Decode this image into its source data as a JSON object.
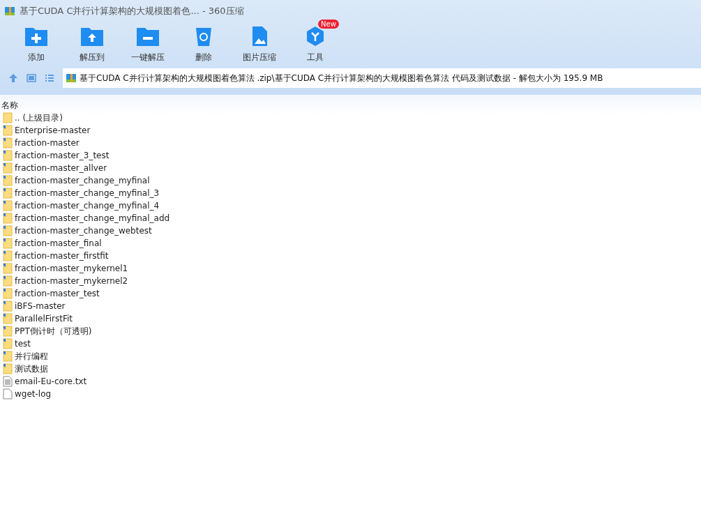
{
  "window": {
    "title": "基于CUDA C并行计算架构的大规模图着色... - 360压缩"
  },
  "toolbar": [
    {
      "label": "添加",
      "kind": "add"
    },
    {
      "label": "解压到",
      "kind": "extract"
    },
    {
      "label": "一键解压",
      "kind": "oneclick"
    },
    {
      "label": "删除",
      "kind": "delete"
    },
    {
      "label": "图片压缩",
      "kind": "image"
    },
    {
      "label": "工具",
      "kind": "tools",
      "badge": "New"
    }
  ],
  "address": {
    "path": "基于CUDA C并行计算架构的大规模图着色算法 .zip\\基于CUDA C并行计算架构的大规模图着色算法 代码及测试数据 - 解包大小为 195.9 MB"
  },
  "table": {
    "columns": [
      "名称"
    ],
    "rows": [
      {
        "name": ".. (上级目录)",
        "kind": "parent"
      },
      {
        "name": "Enterprise-master",
        "kind": "folder"
      },
      {
        "name": "fraction-master",
        "kind": "folder"
      },
      {
        "name": "fraction-master_3_test",
        "kind": "folder"
      },
      {
        "name": "fraction-master_allver",
        "kind": "folder"
      },
      {
        "name": "fraction-master_change_myfinal",
        "kind": "folder"
      },
      {
        "name": "fraction-master_change_myfinal_3",
        "kind": "folder"
      },
      {
        "name": "fraction-master_change_myfinal_4",
        "kind": "folder"
      },
      {
        "name": "fraction-master_change_myfinal_add",
        "kind": "folder"
      },
      {
        "name": "fraction-master_change_webtest",
        "kind": "folder"
      },
      {
        "name": "fraction-master_final",
        "kind": "folder"
      },
      {
        "name": "fraction-master_firstfit",
        "kind": "folder"
      },
      {
        "name": "fraction-master_mykernel1",
        "kind": "folder"
      },
      {
        "name": "fraction-master_mykernel2",
        "kind": "folder"
      },
      {
        "name": "fraction-master_test",
        "kind": "folder"
      },
      {
        "name": "iBFS-master",
        "kind": "folder"
      },
      {
        "name": "ParallelFirstFit",
        "kind": "folder"
      },
      {
        "name": "PPT倒计时（可透明)",
        "kind": "folder"
      },
      {
        "name": "test",
        "kind": "folder"
      },
      {
        "name": "并行编程",
        "kind": "folder"
      },
      {
        "name": "测试数据",
        "kind": "folder"
      },
      {
        "name": "email-Eu-core.txt",
        "kind": "text-file"
      },
      {
        "name": "wget-log",
        "kind": "file"
      }
    ]
  }
}
